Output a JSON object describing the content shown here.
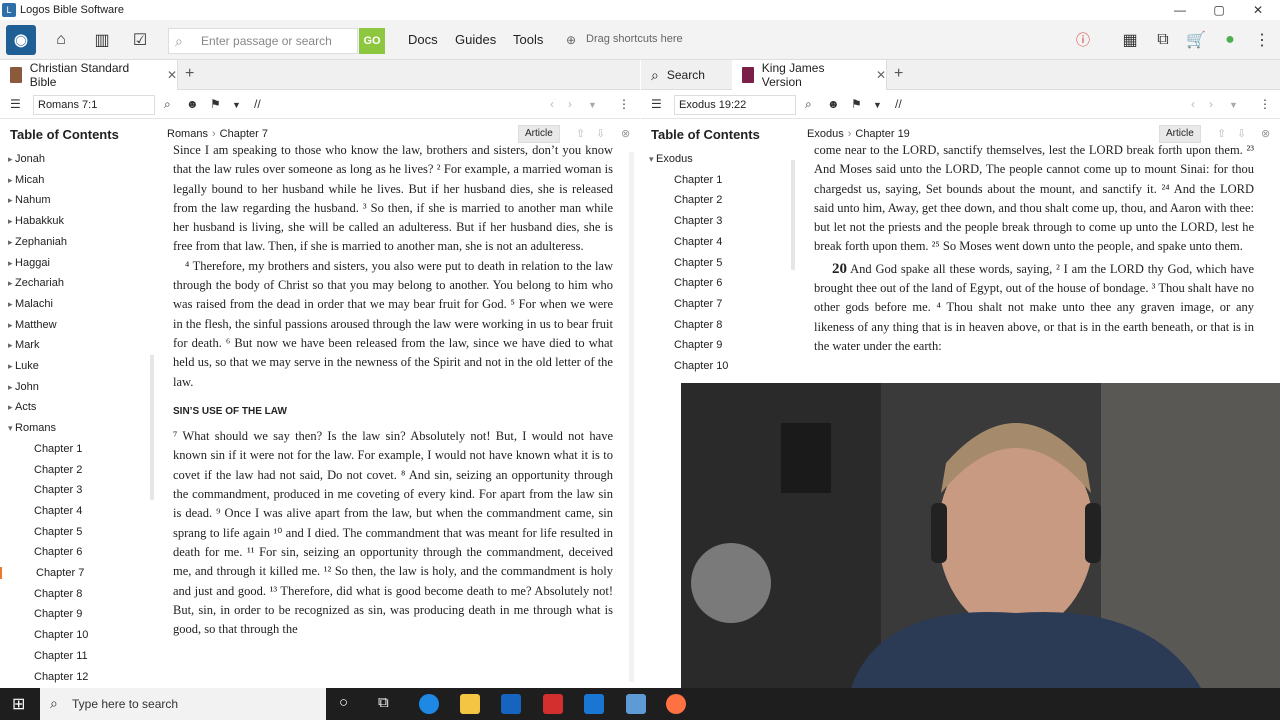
{
  "window": {
    "title": "Logos Bible Software",
    "minimize": "—",
    "maximize": "▢",
    "close": "✕"
  },
  "toolbar": {
    "search_placeholder": "Enter passage or search",
    "go_label": "GO",
    "menus": [
      "Docs",
      "Guides",
      "Tools"
    ],
    "drag_shortcuts": "Drag shortcuts here"
  },
  "left_panel": {
    "tab_label": "Christian Standard Bible",
    "book_color": "#8b5a3c",
    "reference": "Romans 7:1",
    "toc_title": "Table of Contents",
    "breadcrumb_book": "Romans",
    "breadcrumb_chapter": "Chapter 7",
    "article_label": "Article",
    "toc_books": [
      "Jonah",
      "Micah",
      "Nahum",
      "Habakkuk",
      "Zephaniah",
      "Haggai",
      "Zechariah",
      "Malachi",
      "Matthew",
      "Mark",
      "Luke",
      "John",
      "Acts",
      "Romans"
    ],
    "toc_chapters": [
      "Chapter 1",
      "Chapter 2",
      "Chapter 3",
      "Chapter 4",
      "Chapter 5",
      "Chapter 6",
      "Chapter 7",
      "Chapter 8",
      "Chapter 9",
      "Chapter 10",
      "Chapter 11",
      "Chapter 12"
    ],
    "active_chapter": "Chapter 7",
    "text_top": "Since I am speaking to those who know the law, brothers and sisters, don’t you know that the law rules over someone as long as he lives? ² For example, a married woman is legally bound to her husband while he lives. But if her husband dies, she is released from the law regarding the husband. ³ So then, if she is married to another man while her husband is living, she will be called an adulteress. But if her husband dies, she is free from that law. Then, if she is married to another man, she is not an adulteress.",
    "text_v4": "⁴ Therefore, my brothers and sisters, you also were put to death in relation to the law through the body of Christ so that you may belong to another. You belong to him who was raised from the dead in order that we may bear fruit for God. ⁵ For when we were in the flesh, the sinful passions aroused through the law were working in us to bear fruit for death. ⁶ But now we have been released from the law, since we have died to what held us, so that we may serve in the newness of the Spirit and not in the old letter of the law.",
    "section_heading": "SIN’S USE OF THE LAW",
    "text_v7": "⁷ What should we say then? Is the law sin? Absolutely not! But, I would not have known sin if it were not for the law. For example, I would not have known what it is to covet if the law had not said, Do not covet. ⁸ And sin, seizing an opportunity through the commandment, produced in me coveting of every kind. For apart from the law sin is dead. ⁹ Once I was alive apart from the law, but when the commandment came, sin sprang to life again ¹⁰ and I died. The commandment that was meant for life resulted in death for me. ¹¹ For sin, seizing an opportunity through the commandment, deceived me, and through it killed me. ¹² So then, the law is holy, and the commandment is holy and just and good. ¹³ Therefore, did what is good become death to me? Absolutely not! But, sin, in order to be recognized as sin, was producing death in me through what is good, so that through the"
  },
  "right_panel": {
    "search_tab": "Search",
    "tab_label": "King James Version",
    "book_color": "#7a1f4a",
    "reference": "Exodus 19:22",
    "toc_title": "Table of Contents",
    "breadcrumb_book": "Exodus",
    "breadcrumb_chapter": "Chapter 19",
    "article_label": "Article",
    "toc_book": "Exodus",
    "toc_chapters": [
      "Chapter 1",
      "Chapter 2",
      "Chapter 3",
      "Chapter 4",
      "Chapter 5",
      "Chapter 6",
      "Chapter 7",
      "Chapter 8",
      "Chapter 9",
      "Chapter 10"
    ],
    "text_top": "come near to the LORD, sanctify themselves, lest the LORD break forth upon them. ²³ And Moses said unto the LORD, The people cannot come up to mount Sinai: for thou chargedst us, saying, Set bounds about the mount, and sanctify it. ²⁴ And the LORD said unto him, Away, get thee down, and thou shalt come up, thou, and Aaron with thee: but let not the priests and the people break through to come up unto the LORD, lest he break forth upon them. ²⁵ So Moses went down unto the people, and spake unto them.",
    "chapter_number": "20",
    "text_ch20": "And God spake all these words, saying, ² I am the LORD thy God, which have brought thee out of the land of Egypt, out of the house of bondage. ³ Thou shalt have no other gods before me. ⁴ Thou shalt not make unto thee any graven image, or any likeness of any thing that is in heaven above, or that is in the earth beneath, or that is in the water under the earth:"
  },
  "taskbar": {
    "search_placeholder": "Type here to search"
  }
}
